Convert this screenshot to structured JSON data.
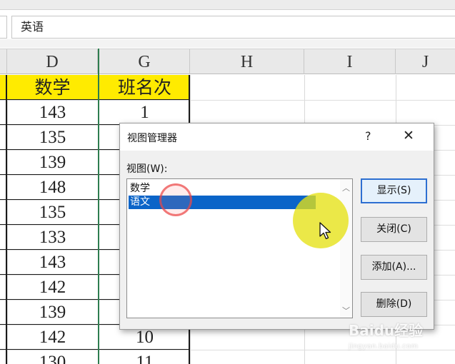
{
  "formula_bar": {
    "value": "英语"
  },
  "column_headers": [
    "D",
    "G",
    "H",
    "I",
    "J"
  ],
  "sheet": {
    "header_row": {
      "D": "数学",
      "G": "班名次"
    },
    "d_values": [
      "143",
      "135",
      "139",
      "148",
      "135",
      "133",
      "143",
      "142",
      "139",
      "142",
      "130"
    ],
    "g_values": [
      "1",
      "",
      "",
      "",
      "",
      "",
      "",
      "",
      "",
      "10",
      "11"
    ]
  },
  "dialog": {
    "title": "视图管理器",
    "help": "?",
    "close": "✕",
    "list_label": "视图(W):",
    "views": [
      "数学",
      "语文"
    ],
    "selected_index": 1,
    "buttons": {
      "show": "显示(S)",
      "close": "关闭(C)",
      "add": "添加(A)...",
      "delete": "删除(D)"
    }
  },
  "watermark": {
    "brand": "Baidu经验",
    "url": "jingyan.baidu.com"
  },
  "colors": {
    "header_fill": "#ffeb00",
    "selection": "#0a64c8",
    "highlight_spot": "#e6e114",
    "click_ring": "#eb4646"
  }
}
